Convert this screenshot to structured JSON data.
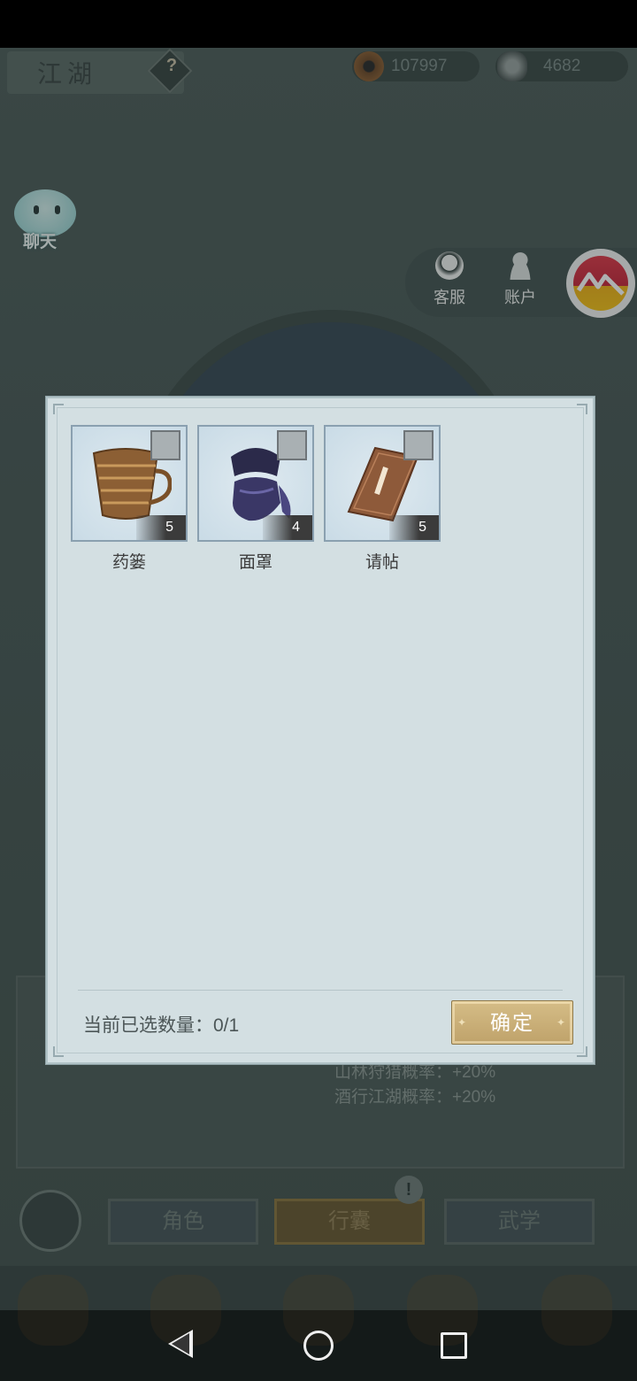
{
  "header": {
    "title": "江湖",
    "help_symbol": "?",
    "coins": "107997",
    "silver": "4682"
  },
  "chat": {
    "label": "聊天"
  },
  "service": {
    "customer_service_label": "客服",
    "account_label": "账户"
  },
  "background_stats": [
    "山林狩猎概率：+20%",
    "酒行江湖概率：+20%"
  ],
  "nav": {
    "role_label": "角色",
    "bag_label": "行囊",
    "martial_label": "武学",
    "alert_symbol": "!"
  },
  "modal": {
    "items": [
      {
        "name": "药篓",
        "count": "5",
        "icon": "basket-icon"
      },
      {
        "name": "面罩",
        "count": "4",
        "icon": "face-mask-icon"
      },
      {
        "name": "请帖",
        "count": "5",
        "icon": "invitation-book-icon"
      }
    ],
    "selected_label": "当前已选数量：0/1",
    "confirm_label": "确定"
  },
  "colors": {
    "modal_bg": "#d3dfe2",
    "confirm_gold": "#c8ad74",
    "bag_tab_active": "#6b5a33"
  }
}
